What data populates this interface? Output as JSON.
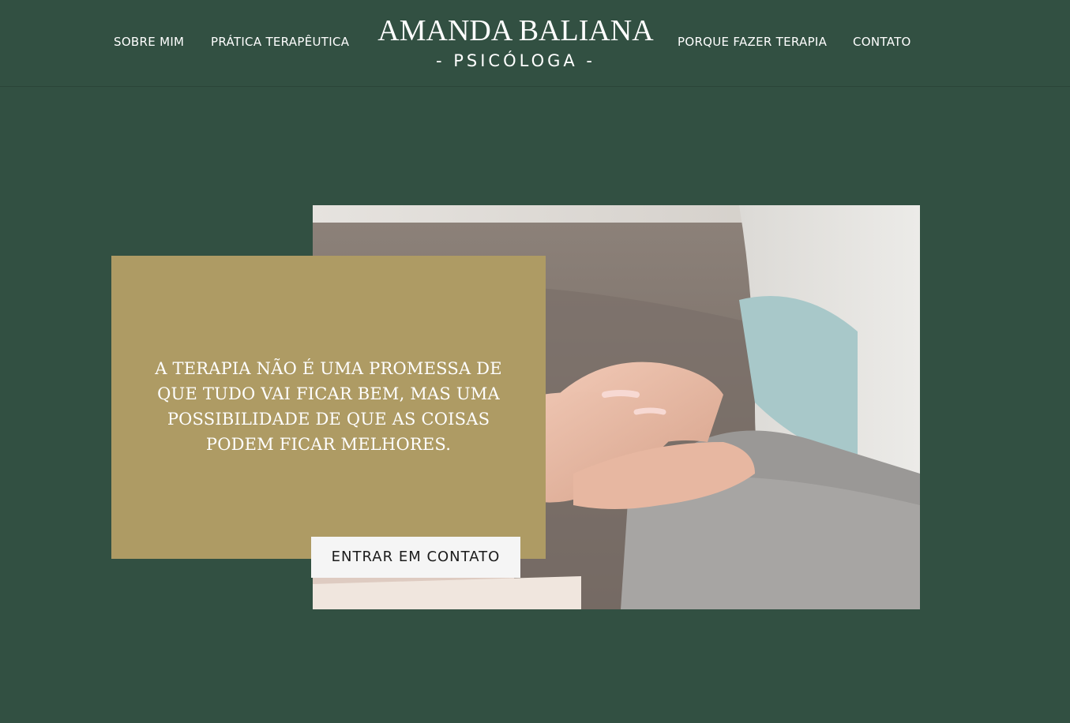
{
  "nav": {
    "left": [
      {
        "label": "SOBRE MIM"
      },
      {
        "label": "PRÁTICA TERAPÊUTICA"
      }
    ],
    "right": [
      {
        "label": "PORQUE FAZER TERAPIA"
      },
      {
        "label": "CONTATO"
      }
    ]
  },
  "logo": {
    "name": "AMANDA BALIANA",
    "subtitle": "- PSICÓLOGA -"
  },
  "hero": {
    "quote": "A TERAPIA NÃO É UMA PROMESSA DE QUE TUDO VAI FICAR BEM, MAS UMA POSSIBILIDADE DE QUE AS COISAS PODEM FICAR MELHORES.",
    "cta_label": "ENTRAR EM CONTATO"
  },
  "colors": {
    "background": "#325042",
    "quote_box": "#ae9b64",
    "button": "#f5f5f5",
    "text_light": "#ffffff"
  }
}
